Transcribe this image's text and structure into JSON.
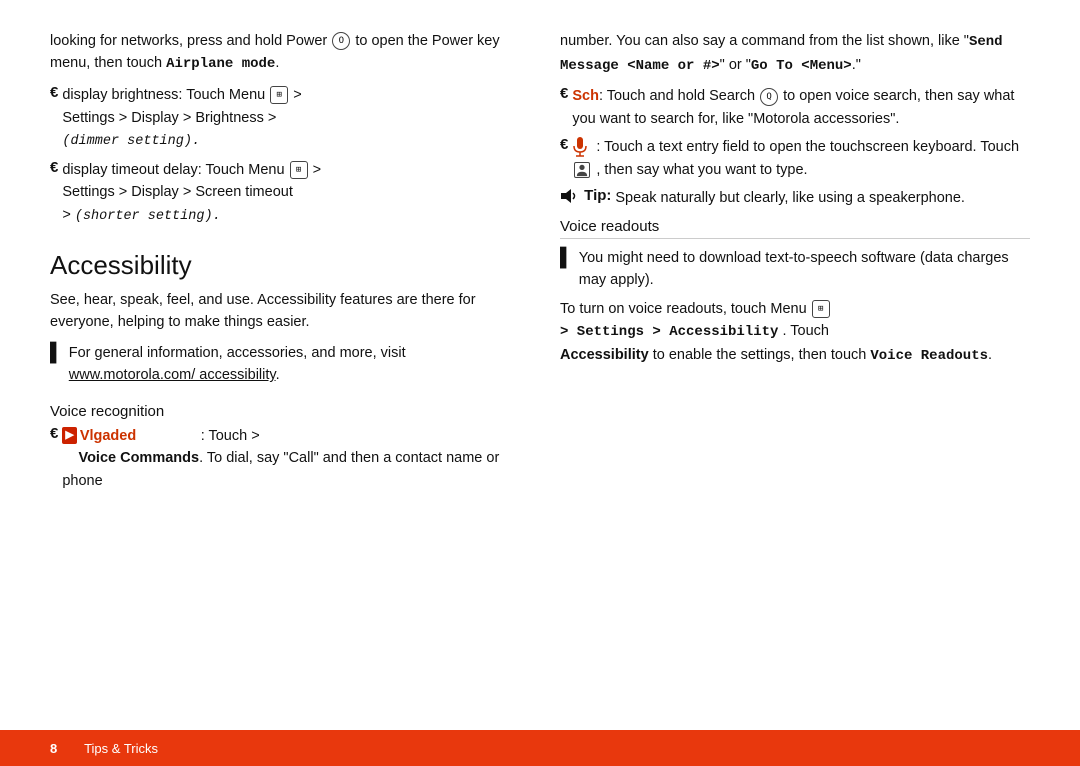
{
  "page": {
    "left_column": {
      "intro_text_1": "looking for networks, press and hold Power",
      "intro_text_2": "to open the Power key menu, then touch",
      "intro_bold": "Airplane mode",
      "intro_text_end": ".",
      "bullet1_prefix": "display brightness: Touch Menu",
      "bullet1_path": "Settings > Display > Brightness >",
      "bullet1_italic": "(dimmer setting).",
      "bullet2_prefix": "display timeout delay: Touch Menu",
      "bullet2_path1": "Settings > Display > Screen timeout",
      "bullet2_path2": "> (shorter setting).",
      "accessibility_title": "Accessibility",
      "accessibility_desc": "See, hear, speak, feel, and use. Accessibility features are there for everyone, helping to make things easier.",
      "bullet3_content": "For general information, accessories, and more, visit",
      "bullet3_link": "www.motorola.com/ accessibility",
      "bullet3_link_end": ".",
      "voice_recognition_header": "Voice recognition",
      "algaded_label": "Vlgaded",
      "algaded_text": ": Touch >",
      "voice_commands_text": "Voice Commands",
      "voice_commands_rest": ". To dial, say \"Call\" and then a contact name or phone"
    },
    "right_column": {
      "intro_text": "number. You can also say a command from the list shown, like \"",
      "send_message": "Send Message <Name or #>",
      "intro_mid": "\" or \"",
      "go_to_menu": "Go To <Menu>",
      "intro_end": ".\"",
      "sch_label": "Sch",
      "sch_text": ": Touch and hold Search",
      "sch_text2": "to open voice search, then say what you want to search for, like \"Motorola accessories\".",
      "mic_text": ": Touch a text entry field to open the touchscreen keyboard. Touch",
      "mic_text2": ", then say what you want to type.",
      "tip_label": "Tip:",
      "tip_text": "Speak naturally but clearly, like using a speakerphone.",
      "voice_readouts_header": "Voice readouts",
      "vr_icon_text": "You might need to download text-to-speech software (data charges may apply).",
      "turn_on_text": "To turn on voice readouts, touch Menu",
      "turn_on_path": "> Settings > Accessibility",
      "turn_on_mid": ". Touch",
      "turn_on_accessibility": "Accessibility",
      "turn_on_rest": "to enable the settings, then touch",
      "turn_on_voice": "Voice Readouts",
      "turn_on_end": "."
    },
    "bottom_bar": {
      "page_number": "8",
      "section_label": "Tips & Tricks"
    }
  }
}
